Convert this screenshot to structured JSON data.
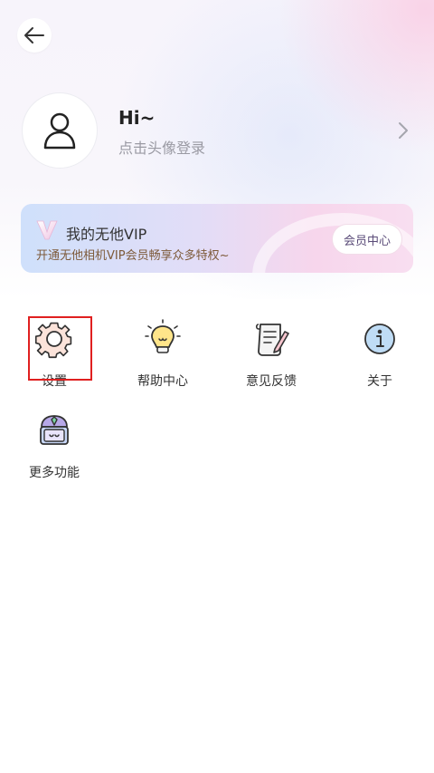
{
  "header": {
    "back_icon": "arrow-left-icon"
  },
  "profile": {
    "greeting": "Hi~",
    "login_hint": "点击头像登录",
    "avatar_icon": "user-icon",
    "chevron_icon": "chevron-right-icon"
  },
  "vip": {
    "title": "我的无他VIP",
    "subtitle": "开通无他相机VIP会员畅享众多特权~",
    "center_button": "会员中心",
    "logo_icon": "vip-v-icon",
    "colors": {
      "card_left": "#cfe0fb",
      "card_right": "#f8def0"
    }
  },
  "menu": {
    "items": [
      {
        "label": "设置",
        "icon": "gear-icon",
        "highlighted": true
      },
      {
        "label": "帮助中心",
        "icon": "lightbulb-icon"
      },
      {
        "label": "意见反馈",
        "icon": "scroll-feedback-icon"
      },
      {
        "label": "关于",
        "icon": "info-icon"
      },
      {
        "label": "更多功能",
        "icon": "treasure-chest-icon"
      }
    ]
  }
}
